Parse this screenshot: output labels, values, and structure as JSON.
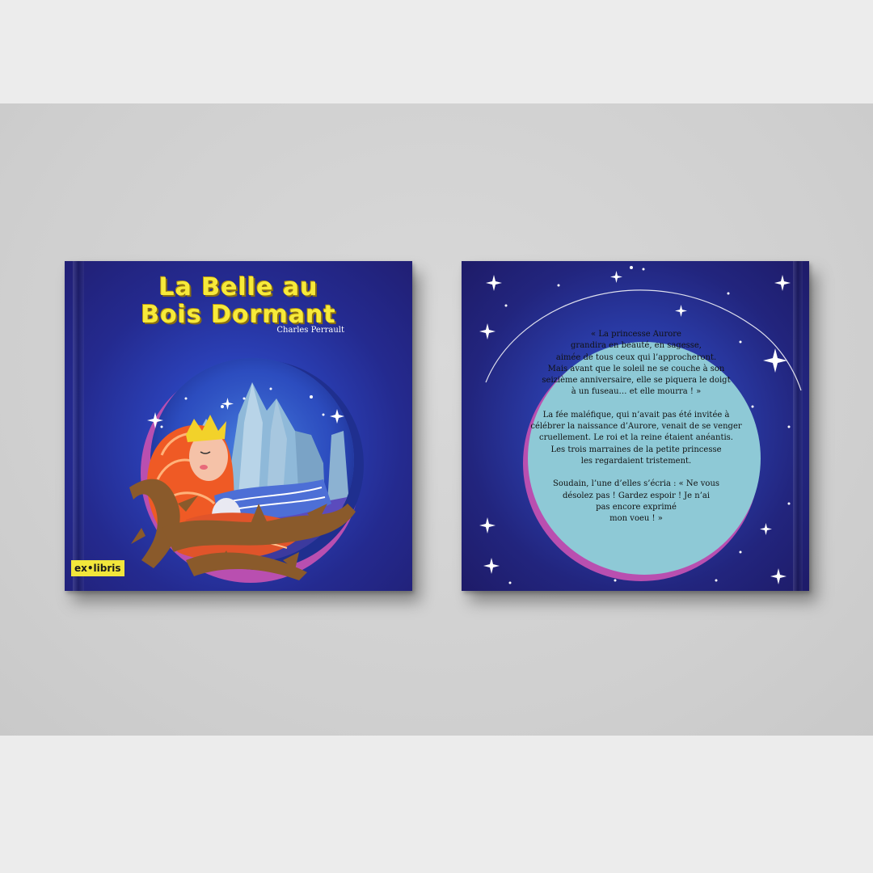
{
  "colors": {
    "cover_blue": "#242a8f",
    "title_yellow": "#f7ea3a",
    "frame_magenta": "#b94fb0",
    "text_circle": "#8ec9d6",
    "logo_yellow": "#f2e63b"
  },
  "front_cover": {
    "title_lines": [
      "La Belle au",
      "Bois Dormant"
    ],
    "author": "Charles Perrault",
    "publisher_logo": "ex•libris"
  },
  "back_cover": {
    "paragraphs": [
      [
        "« La princesse Aurore",
        "grandira en beauté, en sagesse,",
        "aimée de tous ceux qui l’approcheront.",
        "Mais avant que le soleil ne se couche à son",
        "seizième anniversaire, elle se piquera le doigt",
        "à un fuseau… et elle mourra ! »"
      ],
      [
        "La fée maléfique, qui n’avait pas été invitée à",
        "célébrer la naissance d’Aurore, venait de se venger",
        "cruellement. Le roi et la reine étaient anéantis.",
        "Les trois  marraines de la petite princesse",
        "les regardaient tristement."
      ],
      [
        "Soudain, l’une d’elles s’écria : « Ne vous",
        "désolez pas ! Gardez espoir !  Je n’ai",
        "pas encore exprimé",
        "mon voeu ! »"
      ]
    ]
  }
}
